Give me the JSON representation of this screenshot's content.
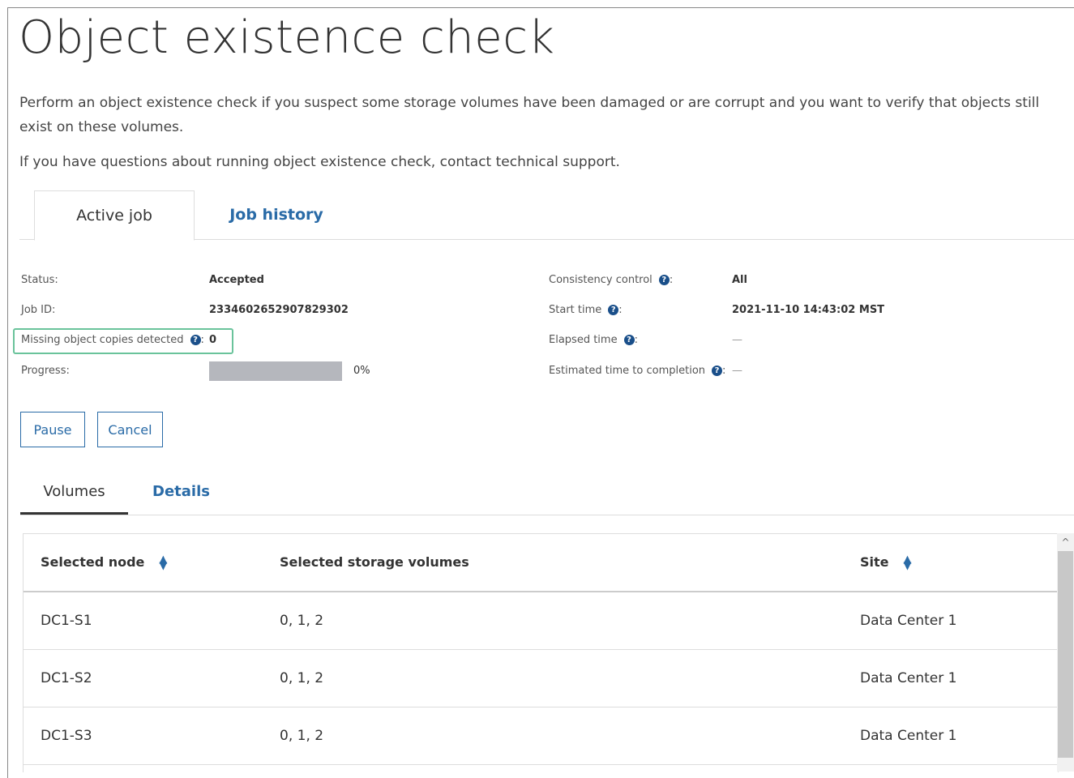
{
  "page": {
    "title": "Object existence check",
    "intro": "Perform an object existence check if you suspect some storage volumes have been damaged or are corrupt and you want to verify that objects still exist on these volumes.",
    "support": "If you have questions about running object existence check, contact technical support."
  },
  "tabs": [
    {
      "label": "Active job"
    },
    {
      "label": "Job history"
    }
  ],
  "details": {
    "status_label": "Status:",
    "status_value": "Accepted",
    "job_id_label": "Job ID:",
    "job_id_value": "2334602652907829302",
    "missing_label": "Missing object copies detected",
    "missing_value": "0",
    "progress_label": "Progress:",
    "progress_value": "0%",
    "progress_fraction": 0,
    "consistency_label": "Consistency control",
    "consistency_value": "All",
    "start_label": "Start time",
    "start_value": "2021-11-10 14:43:02 MST",
    "elapsed_label": "Elapsed time",
    "elapsed_value": "—",
    "estimated_label": "Estimated time to completion",
    "estimated_value": "—",
    "colon": ":"
  },
  "buttons": {
    "pause": "Pause",
    "cancel": "Cancel"
  },
  "subtabs": [
    {
      "label": "Volumes"
    },
    {
      "label": "Details"
    }
  ],
  "table": {
    "columns": [
      "Selected node",
      "Selected storage volumes",
      "Site"
    ],
    "rows": [
      {
        "node": "DC1-S1",
        "volumes": "0, 1, 2",
        "site": "Data Center 1"
      },
      {
        "node": "DC1-S2",
        "volumes": "0, 1, 2",
        "site": "Data Center 1"
      },
      {
        "node": "DC1-S3",
        "volumes": "0, 1, 2",
        "site": "Data Center 1"
      }
    ]
  },
  "icons": {
    "help": "question-circle-icon",
    "sort": "sort-icon",
    "scroll_up": "chevron-up-icon"
  },
  "colors": {
    "link": "#2a6ba7",
    "highlight": "#6ac39b",
    "help_icon": "#1a4f8a"
  }
}
